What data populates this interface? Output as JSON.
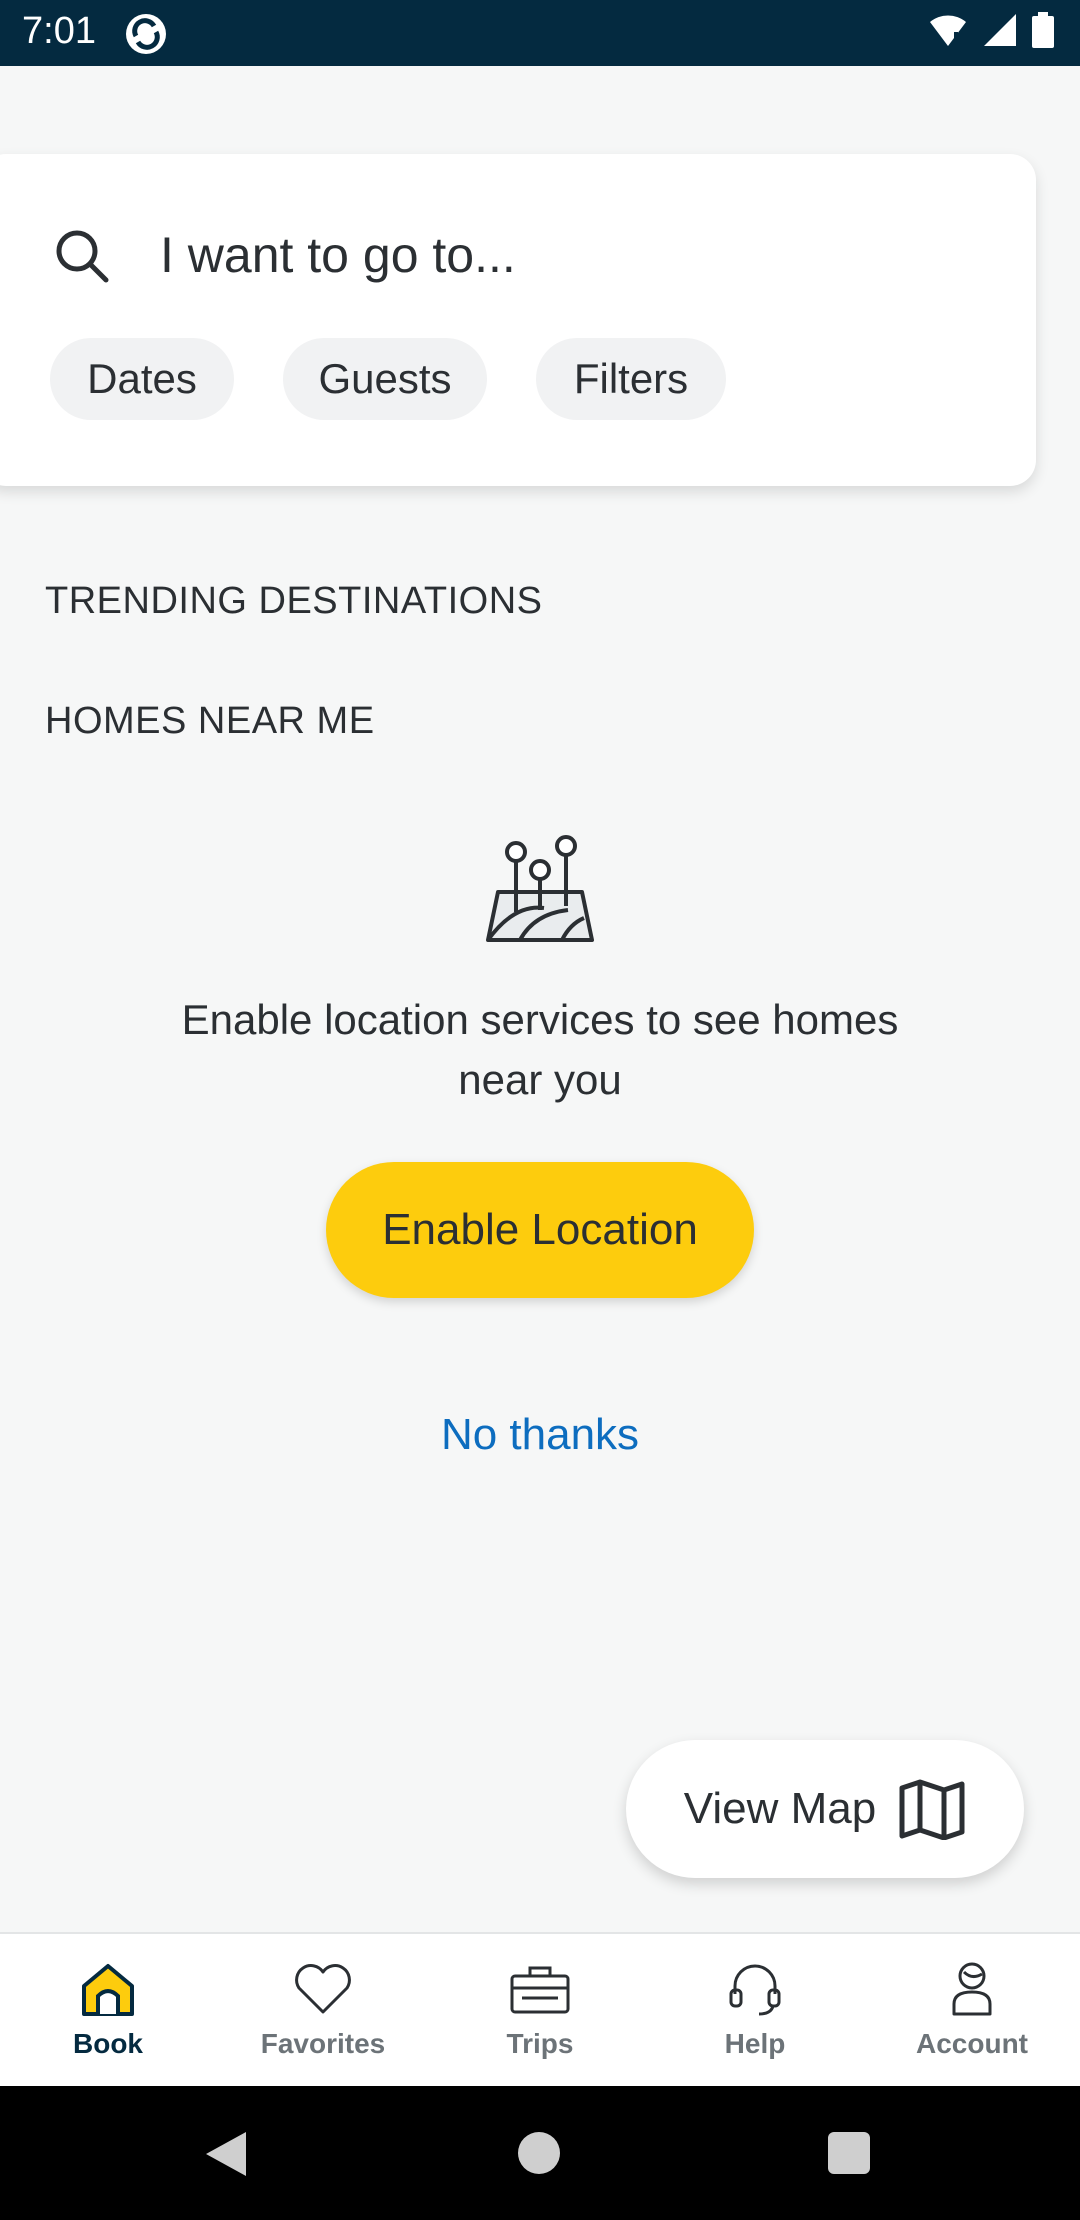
{
  "status_bar": {
    "time": "7:01"
  },
  "search": {
    "placeholder": "I want to go to...",
    "chips": {
      "dates": "Dates",
      "guests": "Guests",
      "filters": "Filters"
    }
  },
  "sections": {
    "trending": "TRENDING DESTINATIONS",
    "homes_near": "HOMES NEAR ME"
  },
  "location_prompt": {
    "message": "Enable location services to see homes near you",
    "enable_button": "Enable Location",
    "dismiss_link": "No thanks"
  },
  "view_map": {
    "label": "View Map"
  },
  "bottom_nav": {
    "items": [
      {
        "label": "Book",
        "icon": "home-icon",
        "active": true
      },
      {
        "label": "Favorites",
        "icon": "heart-icon",
        "active": false
      },
      {
        "label": "Trips",
        "icon": "suitcase-icon",
        "active": false
      },
      {
        "label": "Help",
        "icon": "headset-icon",
        "active": false
      },
      {
        "label": "Account",
        "icon": "person-icon",
        "active": false
      }
    ]
  },
  "colors": {
    "status_bar": "#042a40",
    "accent_yellow": "#fdcc0d",
    "link_blue": "#0d6dbf",
    "background": "#f6f7f7"
  }
}
